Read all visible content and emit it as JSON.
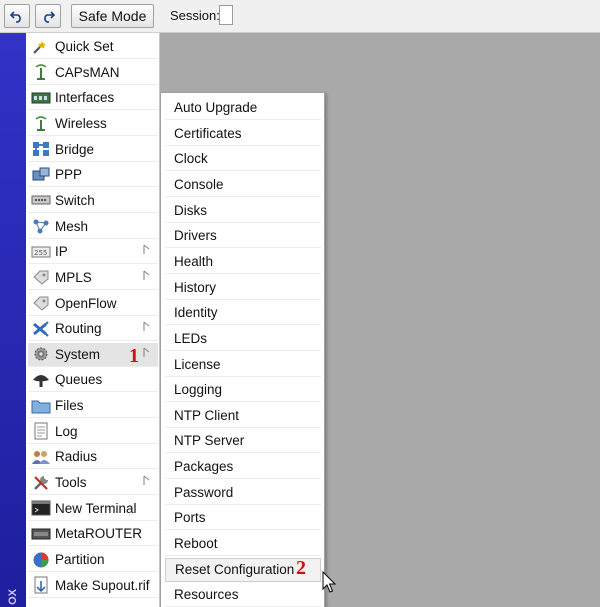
{
  "toolbar": {
    "undo_icon": "undo-icon",
    "redo_icon": "redo-icon",
    "safe_mode_label": "Safe Mode",
    "session_label": "Session:",
    "session_value": ""
  },
  "sidebar": {
    "vertical_text": "OX",
    "items": [
      {
        "label": "Quick Set",
        "icon": "quick-set-icon"
      },
      {
        "label": "CAPsMAN",
        "icon": "antenna-icon"
      },
      {
        "label": "Interfaces",
        "icon": "interfaces-icon"
      },
      {
        "label": "Wireless",
        "icon": "wireless-icon"
      },
      {
        "label": "Bridge",
        "icon": "bridge-icon"
      },
      {
        "label": "PPP",
        "icon": "ppp-icon"
      },
      {
        "label": "Switch",
        "icon": "switch-icon"
      },
      {
        "label": "Mesh",
        "icon": "mesh-icon"
      },
      {
        "label": "IP",
        "icon": "ip-icon",
        "submenu": true
      },
      {
        "label": "MPLS",
        "icon": "mpls-icon",
        "submenu": true
      },
      {
        "label": "OpenFlow",
        "icon": "openflow-icon"
      },
      {
        "label": "Routing",
        "icon": "routing-icon",
        "submenu": true
      },
      {
        "label": "System",
        "icon": "gear-icon",
        "submenu": true,
        "active": true
      },
      {
        "label": "Queues",
        "icon": "queues-icon"
      },
      {
        "label": "Files",
        "icon": "folder-icon"
      },
      {
        "label": "Log",
        "icon": "log-icon"
      },
      {
        "label": "Radius",
        "icon": "radius-icon"
      },
      {
        "label": "Tools",
        "icon": "tools-icon",
        "submenu": true
      },
      {
        "label": "New Terminal",
        "icon": "terminal-icon"
      },
      {
        "label": "MetaROUTER",
        "icon": "metarouter-icon"
      },
      {
        "label": "Partition",
        "icon": "partition-icon"
      },
      {
        "label": "Make Supout.rif",
        "icon": "supout-icon"
      }
    ]
  },
  "system_submenu": {
    "items": [
      "Auto Upgrade",
      "Certificates",
      "Clock",
      "Console",
      "Disks",
      "Drivers",
      "Health",
      "History",
      "Identity",
      "LEDs",
      "License",
      "Logging",
      "NTP Client",
      "NTP Server",
      "Packages",
      "Password",
      "Ports",
      "Reboot",
      "Reset Configuration",
      "Resources"
    ],
    "hovered": "Reset Configuration"
  },
  "annotations": {
    "step1": "1",
    "step2": "2",
    "color": "#d21010"
  },
  "colors": {
    "sidebar_bar": "#2a2ab8",
    "workspace": "#a9a9a9"
  }
}
